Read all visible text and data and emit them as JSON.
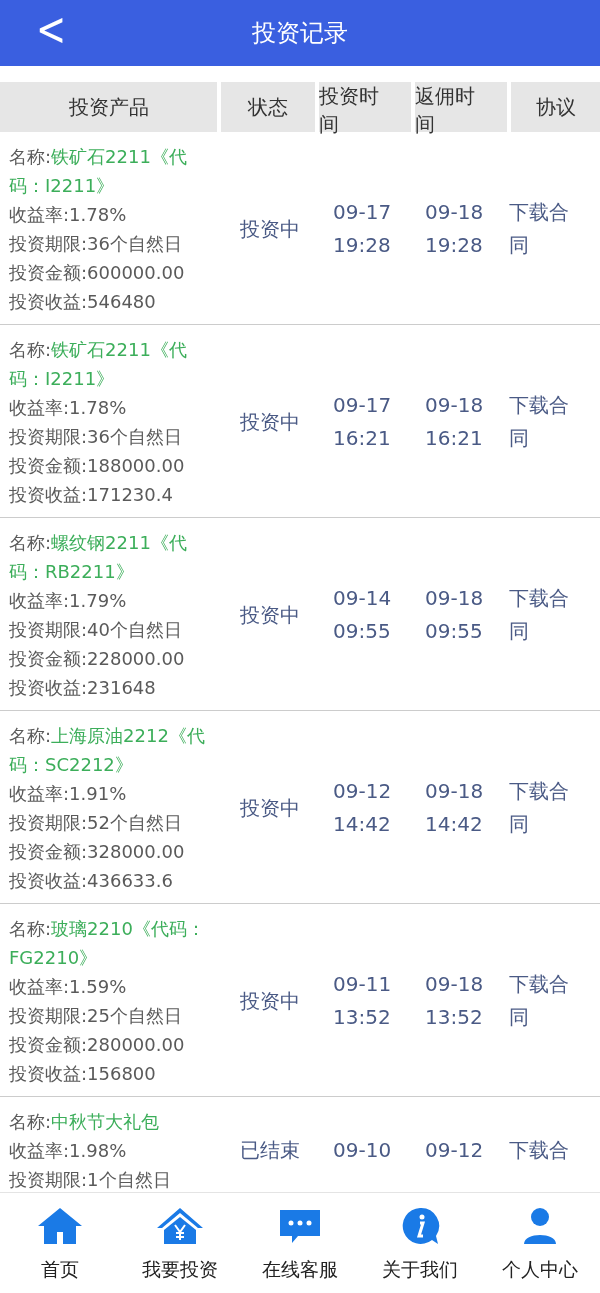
{
  "header": {
    "back": "<",
    "title": "投资记录"
  },
  "table": {
    "columns": [
      "投资产品",
      "状态",
      "投资时间",
      "返佣时间",
      "协议"
    ],
    "rows": [
      {
        "name_label": "名称:",
        "name": "铁矿石2211《代码：I2211》",
        "details": [
          "收益率:1.78%",
          "投资期限:36个自然日",
          "投资金额:600000.00",
          "投资收益:546480"
        ],
        "status": "投资中",
        "invest_time": "09-17 19:28",
        "rebate_time": "09-18 19:28",
        "agreement": "下载合同"
      },
      {
        "name_label": "名称:",
        "name": "铁矿石2211《代码：I2211》",
        "details": [
          "收益率:1.78%",
          "投资期限:36个自然日",
          "投资金额:188000.00",
          "投资收益:171230.4"
        ],
        "status": "投资中",
        "invest_time": "09-17 16:21",
        "rebate_time": "09-18 16:21",
        "agreement": "下载合同"
      },
      {
        "name_label": "名称:",
        "name": "螺纹钢2211《代码：RB2211》",
        "details": [
          "收益率:1.79%",
          "投资期限:40个自然日",
          "投资金额:228000.00",
          "投资收益:231648"
        ],
        "status": "投资中",
        "invest_time": "09-14 09:55",
        "rebate_time": "09-18 09:55",
        "agreement": "下载合同"
      },
      {
        "name_label": "名称:",
        "name": "上海原油2212《代码：SC2212》",
        "details": [
          "收益率:1.91%",
          "投资期限:52个自然日",
          "投资金额:328000.00",
          "投资收益:436633.6"
        ],
        "status": "投资中",
        "invest_time": "09-12 14:42",
        "rebate_time": "09-18 14:42",
        "agreement": "下载合同"
      },
      {
        "name_label": "名称:",
        "name": "玻璃2210《代码：FG2210》",
        "details": [
          "收益率:1.59%",
          "投资期限:25个自然日",
          "投资金额:280000.00",
          "投资收益:156800"
        ],
        "status": "投资中",
        "invest_time": "09-11 13:52",
        "rebate_time": "09-18 13:52",
        "agreement": "下载合同"
      },
      {
        "name_label": "名称:",
        "name": "中秋节大礼包",
        "details": [
          "收益率:1.98%",
          "投资期限:1个自然日"
        ],
        "status": "已结束",
        "invest_time": "09-10",
        "rebate_time": "09-12",
        "agreement": "下载合"
      }
    ]
  },
  "nav": [
    {
      "kind": "home",
      "label": "首页"
    },
    {
      "kind": "invest",
      "label": "我要投资"
    },
    {
      "kind": "chat",
      "label": "在线客服"
    },
    {
      "kind": "info",
      "label": "关于我们"
    },
    {
      "kind": "user",
      "label": "个人中心"
    }
  ]
}
